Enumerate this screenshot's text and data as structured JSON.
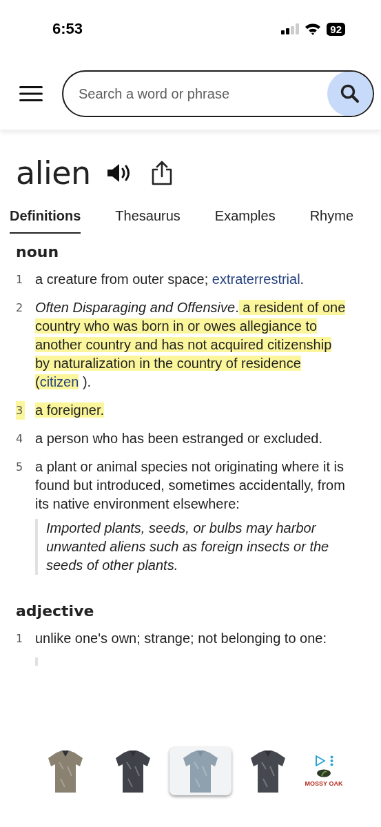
{
  "status_bar": {
    "time": "6:53",
    "battery": "92"
  },
  "search": {
    "placeholder": "Search a word or phrase"
  },
  "word": "alien",
  "tabs": [
    {
      "label": "Definitions",
      "selected": true
    },
    {
      "label": "Thesaurus",
      "selected": false
    },
    {
      "label": "Examples",
      "selected": false
    },
    {
      "label": "Rhyme",
      "selected": false
    }
  ],
  "sections": [
    {
      "part_of_speech": "noun",
      "definitions": [
        {
          "number": "1",
          "highlighted": false,
          "parts": [
            {
              "text": "a creature from outer space; ",
              "kind": "plain",
              "highlighted": false
            },
            {
              "text": "extraterrestrial",
              "kind": "link",
              "highlighted": false
            },
            {
              "text": ".",
              "kind": "plain",
              "highlighted": false
            }
          ]
        },
        {
          "number": "2",
          "highlighted": false,
          "parts": [
            {
              "text": "Often Disparaging and Offensive",
              "kind": "italic",
              "highlighted": false
            },
            {
              "text": ".",
              "kind": "plain",
              "highlighted": false
            },
            {
              "text": " a resident of one country who was born in or owes allegiance to another country and has not acquired citizenship by naturalization in the country of residence (",
              "kind": "plain",
              "highlighted": true
            },
            {
              "text": "citizen",
              "kind": "link",
              "highlighted": true
            },
            {
              "text": " ).",
              "kind": "plain",
              "highlighted": false
            }
          ]
        },
        {
          "number": "3",
          "highlighted": true,
          "parts": [
            {
              "text": "a foreigner.",
              "kind": "plain",
              "highlighted": true
            }
          ]
        },
        {
          "number": "4",
          "highlighted": false,
          "parts": [
            {
              "text": "a person who has been estranged or excluded.",
              "kind": "plain",
              "highlighted": false
            }
          ]
        },
        {
          "number": "5",
          "highlighted": false,
          "parts": [
            {
              "text": "a plant or animal species not originating where it is found but introduced, sometimes accidentally, from its native environment elsewhere:",
              "kind": "plain",
              "highlighted": false
            }
          ],
          "example": "Imported plants, seeds, or bulbs may harbor unwanted aliens such as foreign insects or the seeds of other plants."
        }
      ]
    },
    {
      "part_of_speech": "adjective",
      "definitions": [
        {
          "number": "1",
          "highlighted": false,
          "parts": [
            {
              "text": "unlike one's own; strange; not belonging to one:",
              "kind": "plain",
              "highlighted": false
            }
          ]
        }
      ]
    }
  ],
  "ad": {
    "brand": "MOSSY OAK"
  }
}
